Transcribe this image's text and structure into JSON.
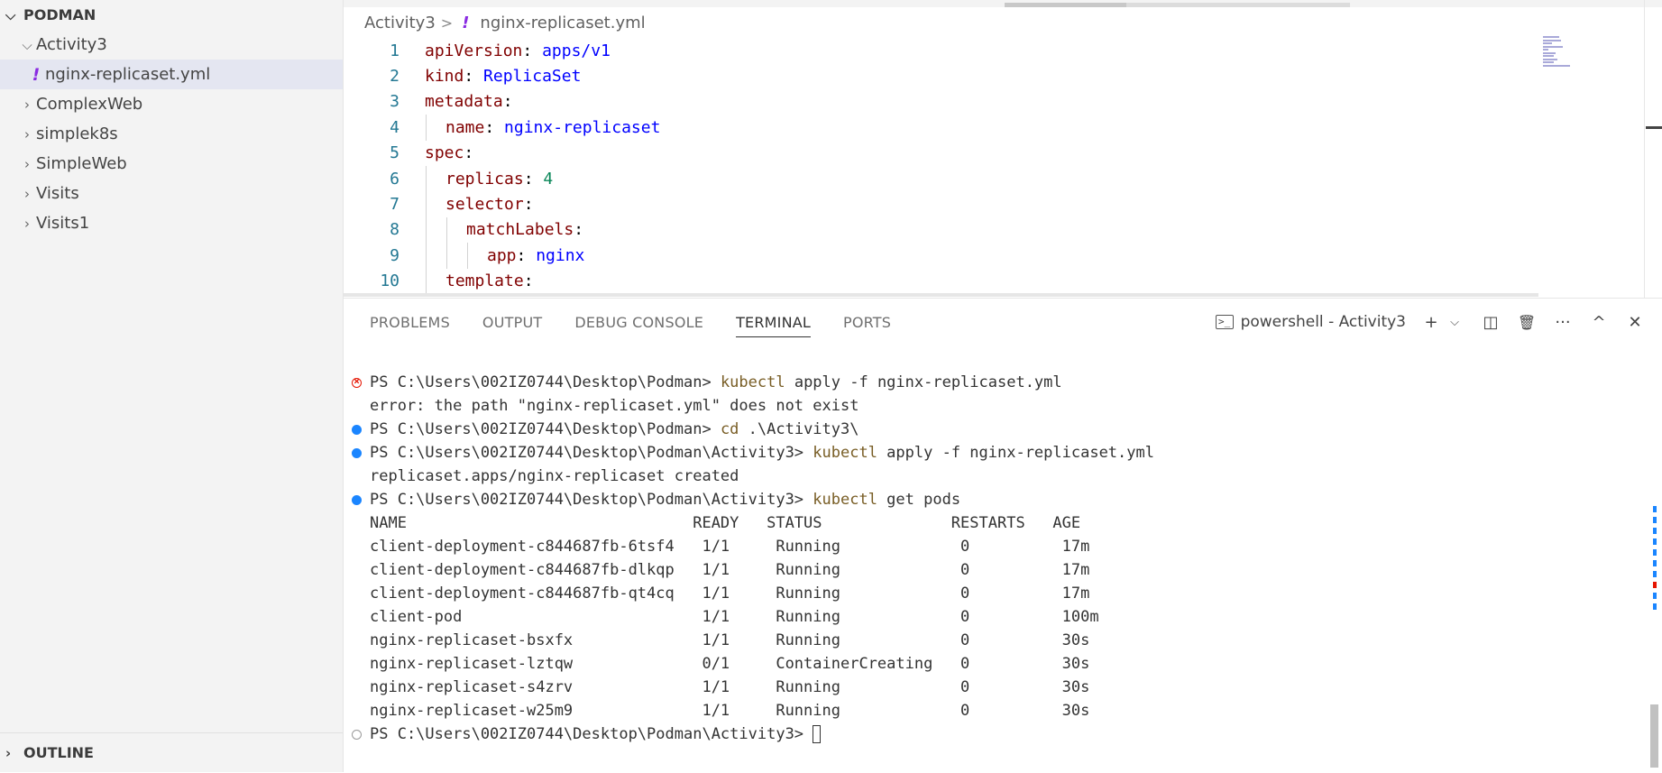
{
  "explorer": {
    "root": "PODMAN",
    "items": [
      {
        "label": "Activity3",
        "expanded": true,
        "level": 1
      },
      {
        "label": "nginx-replicaset.yml",
        "type": "file",
        "level": 2,
        "selected": true
      },
      {
        "label": "ComplexWeb",
        "expanded": false,
        "level": 1
      },
      {
        "label": "simplek8s",
        "expanded": false,
        "level": 1
      },
      {
        "label": "SimpleWeb",
        "expanded": false,
        "level": 1
      },
      {
        "label": "Visits",
        "expanded": false,
        "level": 1
      },
      {
        "label": "Visits1",
        "expanded": false,
        "level": 1
      }
    ],
    "outline": "OUTLINE"
  },
  "editor": {
    "breadcrumb": {
      "folder": "Activity3",
      "separator": ">",
      "file_marker": "!",
      "file": "nginx-replicaset.yml"
    },
    "lines": [
      {
        "num": "1",
        "indent": 0,
        "key": "apiVersion",
        "value": "apps/v1"
      },
      {
        "num": "2",
        "indent": 0,
        "key": "kind",
        "value": "ReplicaSet"
      },
      {
        "num": "3",
        "indent": 0,
        "key": "metadata",
        "value": ""
      },
      {
        "num": "4",
        "indent": 1,
        "key": "name",
        "value": "nginx-replicaset"
      },
      {
        "num": "5",
        "indent": 0,
        "key": "spec",
        "value": ""
      },
      {
        "num": "6",
        "indent": 1,
        "key": "replicas",
        "value": "4",
        "numeric": true
      },
      {
        "num": "7",
        "indent": 1,
        "key": "selector",
        "value": ""
      },
      {
        "num": "8",
        "indent": 2,
        "key": "matchLabels",
        "value": ""
      },
      {
        "num": "9",
        "indent": 3,
        "key": "app",
        "value": "nginx"
      },
      {
        "num": "10",
        "indent": 1,
        "key": "template",
        "value": ""
      }
    ]
  },
  "panel": {
    "tabs": [
      "PROBLEMS",
      "OUTPUT",
      "DEBUG CONSOLE",
      "TERMINAL",
      "PORTS"
    ],
    "active_tab": "TERMINAL",
    "terminal_name": "powershell - Activity3",
    "actions": {
      "add": "+",
      "dropdown": "⌵",
      "split": "◫",
      "kill": "🗑",
      "more": "···",
      "maximize": "^",
      "close": "✕"
    }
  },
  "terminal": {
    "lines": [
      {
        "deco": "err",
        "prompt": "PS C:\\Users\\002IZ0744\\Desktop\\Podman> ",
        "cmd": "kubectl",
        "rest": " apply -f nginx-replicaset.yml"
      },
      {
        "deco": "none",
        "text": "error: the path \"nginx-replicaset.yml\" does not exist"
      },
      {
        "deco": "blue",
        "prompt": "PS C:\\Users\\002IZ0744\\Desktop\\Podman> ",
        "cmd": "cd",
        "rest": " .\\Activity3\\"
      },
      {
        "deco": "blue",
        "prompt": "PS C:\\Users\\002IZ0744\\Desktop\\Podman\\Activity3> ",
        "cmd": "kubectl",
        "rest": " apply -f nginx-replicaset.yml"
      },
      {
        "deco": "none",
        "text": "replicaset.apps/nginx-replicaset created"
      },
      {
        "deco": "blue",
        "prompt": "PS C:\\Users\\002IZ0744\\Desktop\\Podman\\Activity3> ",
        "cmd": "kubectl",
        "rest": " get pods"
      },
      {
        "deco": "none",
        "text": "NAME                               READY   STATUS              RESTARTS   AGE"
      },
      {
        "deco": "none",
        "text": "client-deployment-c844687fb-6tsf4   1/1     Running             0          17m"
      },
      {
        "deco": "none",
        "text": "client-deployment-c844687fb-dlkqp   1/1     Running             0          17m"
      },
      {
        "deco": "none",
        "text": "client-deployment-c844687fb-qt4cq   1/1     Running             0          17m"
      },
      {
        "deco": "none",
        "text": "client-pod                          1/1     Running             0          100m"
      },
      {
        "deco": "none",
        "text": "nginx-replicaset-bsxfx              1/1     Running             0          30s"
      },
      {
        "deco": "none",
        "text": "nginx-replicaset-lztqw              0/1     ContainerCreating   0          30s"
      },
      {
        "deco": "none",
        "text": "nginx-replicaset-s4zrv              1/1     Running             0          30s"
      },
      {
        "deco": "none",
        "text": "nginx-replicaset-w25m9              1/1     Running             0          30s"
      },
      {
        "deco": "empty",
        "prompt": "PS C:\\Users\\002IZ0744\\Desktop\\Podman\\Activity3> ",
        "cmd": "",
        "rest": "",
        "cursor": true
      }
    ]
  },
  "colors": {
    "accent_blue": "#1a85ff",
    "error_red": "#e51400",
    "yaml_key": "#800000",
    "yaml_value": "#0000ff",
    "yaml_number": "#098658",
    "command": "#795e26"
  }
}
